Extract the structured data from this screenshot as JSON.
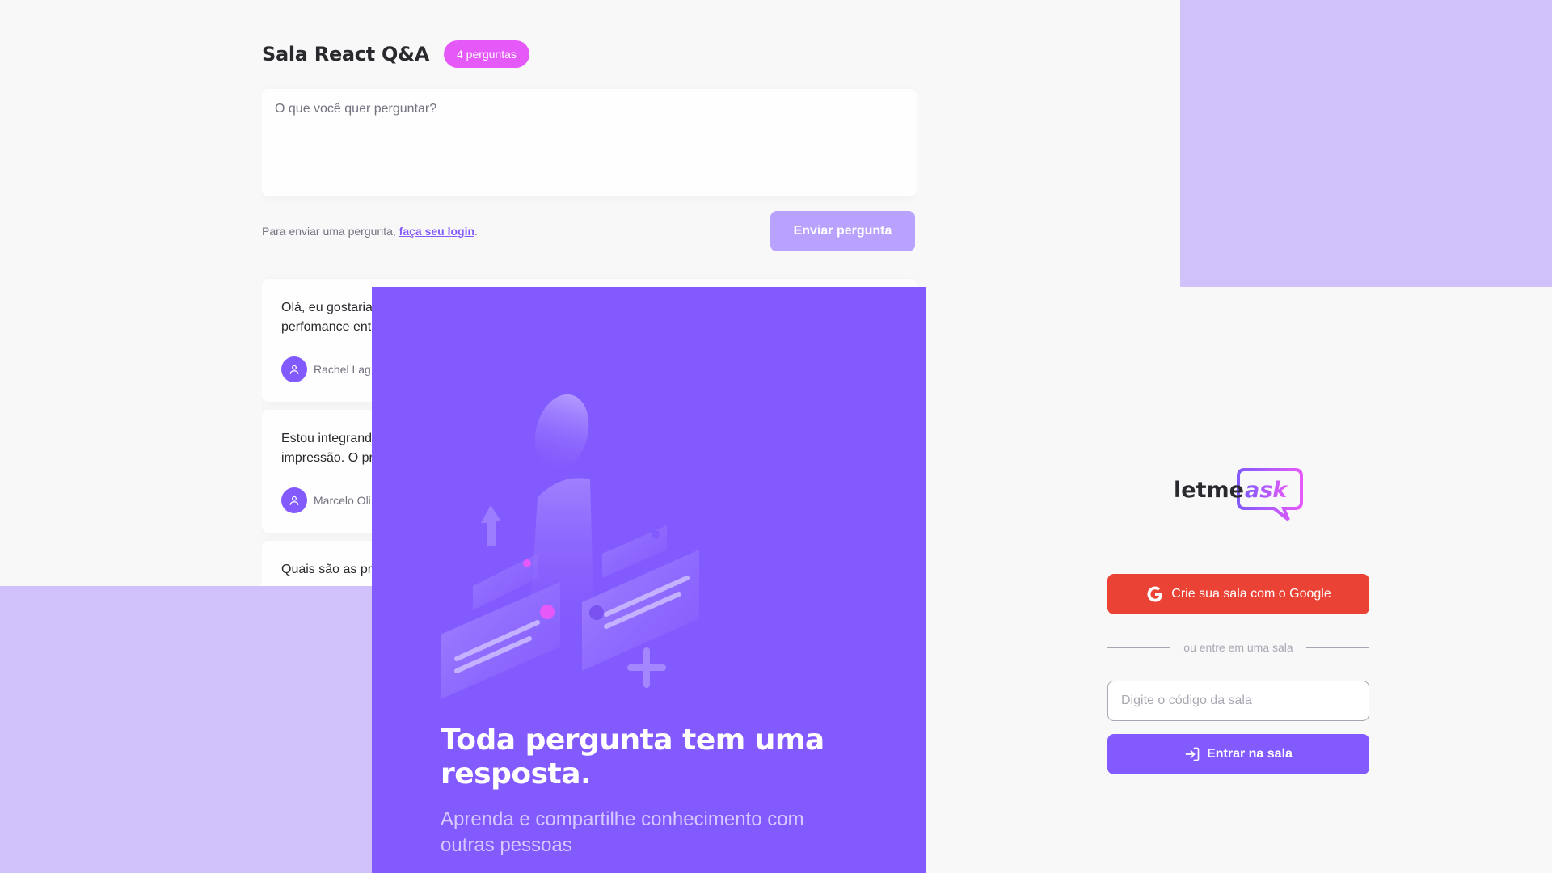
{
  "room": {
    "title": "Sala React Q&A",
    "badge": "4 perguntas",
    "textarea_placeholder": "O que você quer perguntar?",
    "login_hint_prefix": "Para enviar uma pergunta, ",
    "login_link": "faça seu login",
    "login_hint_suffix": ".",
    "send_button": "Enviar pergunta",
    "questions": [
      {
        "text": "Olá, eu gostaria",
        "text_line2": "perfomance ent",
        "author": "Rachel Lag"
      },
      {
        "text": "Estou integrand",
        "text_line2": "impressão. O pr",
        "author": "Marcelo Oli"
      },
      {
        "text": "Quais são as pr",
        "text_line2": "",
        "author": ""
      }
    ]
  },
  "aside": {
    "title": "Toda pergunta tem uma resposta.",
    "subtitle": "Aprenda e compartilhe conhecimento com outras pessoas"
  },
  "login": {
    "logo_text_1": "letme",
    "logo_text_2": "ask",
    "google_button": "Crie sua sala com o Google",
    "separator": "ou entre em uma sala",
    "room_code_placeholder": "Digite o código da sala",
    "enter_button": "Entrar na sala"
  },
  "colors": {
    "primary": "#835afd",
    "badge": "#e559f9",
    "google": "#ea4335",
    "lavender": "#d0c1fa"
  },
  "icons": [
    "user-icon",
    "google-icon",
    "log-in-icon"
  ]
}
